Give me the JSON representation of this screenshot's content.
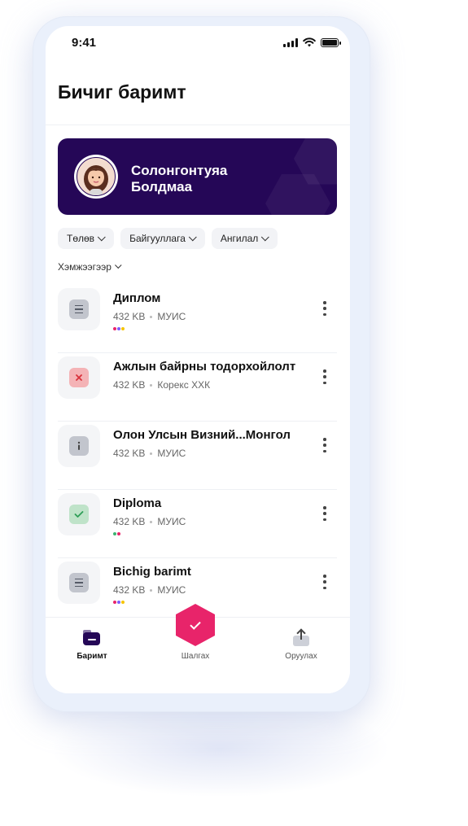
{
  "status_bar": {
    "time": "9:41"
  },
  "header": {
    "title": "Бичиг баримт"
  },
  "profile": {
    "name": "Солонгонтуяа Болдмаа"
  },
  "filters": [
    {
      "label": "Төлөв"
    },
    {
      "label": "Байгууллага"
    },
    {
      "label": "Ангилал"
    }
  ],
  "sort": {
    "label": "Хэмжээгээр"
  },
  "documents": [
    {
      "title": "Диплом",
      "size": "432 KB",
      "org": "МУИС",
      "status_icon": "document-icon",
      "tag_colors": [
        "#e8246a",
        "#7b5cff",
        "#f5c400"
      ]
    },
    {
      "title": "Ажлын байрны тодорхойлолт",
      "size": "432 KB",
      "org": "Корекс ХХК",
      "status_icon": "error-icon",
      "tag_colors": []
    },
    {
      "title": "Олон Улсын Визний...Монгол",
      "size": "432 KB",
      "org": "МУИС",
      "status_icon": "info-icon",
      "tag_colors": []
    },
    {
      "title": "Diploma",
      "size": "432 KB",
      "org": "МУИС",
      "status_icon": "check-icon",
      "tag_colors": [
        "#3cb371",
        "#e8246a"
      ]
    },
    {
      "title": "Bichig barimt",
      "size": "432 KB",
      "org": "МУИС",
      "status_icon": "document-icon",
      "tag_colors": [
        "#e8246a",
        "#7b5cff",
        "#f5c400"
      ]
    }
  ],
  "bottom_nav": {
    "documents_label": "Баримт",
    "scan_label": "Шалгах",
    "upload_label": "Оруулах"
  },
  "colors": {
    "accent": "#e8246a",
    "brand": "#250757"
  }
}
